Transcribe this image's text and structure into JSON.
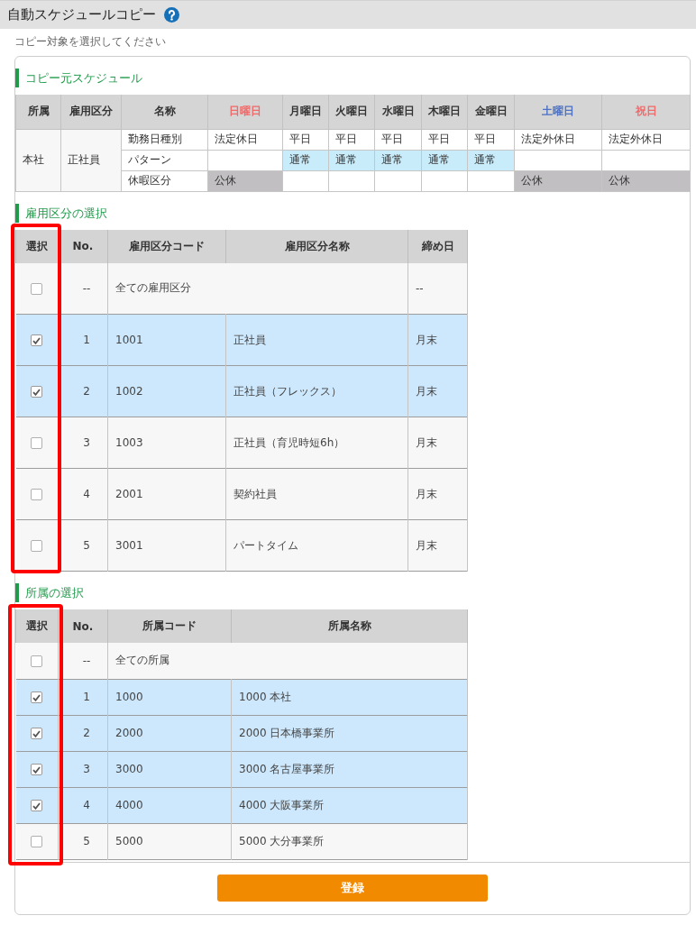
{
  "header": {
    "title": "自動スケジュールコピー"
  },
  "instruction": "コピー対象を選択してください",
  "source_schedule": {
    "title": "コピー元スケジュール",
    "columns": [
      {
        "label": "所属",
        "kind": "key"
      },
      {
        "label": "雇用区分",
        "kind": "key"
      },
      {
        "label": "名称",
        "kind": "key"
      },
      {
        "label": "日曜日",
        "kind": "sunday"
      },
      {
        "label": "月曜日",
        "kind": "weekday"
      },
      {
        "label": "火曜日",
        "kind": "weekday"
      },
      {
        "label": "水曜日",
        "kind": "weekday"
      },
      {
        "label": "木曜日",
        "kind": "weekday"
      },
      {
        "label": "金曜日",
        "kind": "weekday"
      },
      {
        "label": "土曜日",
        "kind": "saturday"
      },
      {
        "label": "祝日",
        "kind": "holiday"
      }
    ],
    "rows": [
      {
        "cells": [
          {
            "kind": "key",
            "text": "本社",
            "rowspan": 3
          },
          {
            "kind": "key",
            "text": "正社員",
            "rowspan": 3
          },
          {
            "kind": "label",
            "text": "勤務日種別"
          },
          {
            "kind": "plain",
            "text": "法定休日"
          },
          {
            "kind": "plain",
            "text": "平日"
          },
          {
            "kind": "plain",
            "text": "平日"
          },
          {
            "kind": "plain",
            "text": "平日"
          },
          {
            "kind": "plain",
            "text": "平日"
          },
          {
            "kind": "plain",
            "text": "平日"
          },
          {
            "kind": "plain",
            "text": "法定外休日"
          },
          {
            "kind": "plain",
            "text": "法定外休日"
          }
        ]
      },
      {
        "cells": [
          {
            "kind": "label",
            "text": "パターン"
          },
          {
            "kind": "plain",
            "text": ""
          },
          {
            "kind": "pattern",
            "text": "通常"
          },
          {
            "kind": "pattern",
            "text": "通常"
          },
          {
            "kind": "pattern",
            "text": "通常"
          },
          {
            "kind": "pattern",
            "text": "通常"
          },
          {
            "kind": "pattern",
            "text": "通常"
          },
          {
            "kind": "plain",
            "text": ""
          },
          {
            "kind": "plain",
            "text": ""
          }
        ]
      },
      {
        "cells": [
          {
            "kind": "label",
            "text": "休暇区分"
          },
          {
            "kind": "off",
            "text": "公休"
          },
          {
            "kind": "plain",
            "text": ""
          },
          {
            "kind": "plain",
            "text": ""
          },
          {
            "kind": "plain",
            "text": ""
          },
          {
            "kind": "plain",
            "text": ""
          },
          {
            "kind": "plain",
            "text": ""
          },
          {
            "kind": "off",
            "text": "公休"
          },
          {
            "kind": "off",
            "text": "公休"
          }
        ]
      }
    ]
  },
  "employment_selection": {
    "title": "雇用区分の選択",
    "select_column_highlighted": true,
    "columns": [
      "選択",
      "No.",
      "雇用区分コード",
      "雇用区分名称",
      "締め日"
    ],
    "all_row": {
      "checked": false,
      "no": "--",
      "label": "全ての雇用区分",
      "closing_day": "--"
    },
    "rows": [
      {
        "checked": true,
        "no": "1",
        "code": "1001",
        "name": "正社員",
        "closing_day": "月末"
      },
      {
        "checked": true,
        "no": "2",
        "code": "1002",
        "name": "正社員（フレックス）",
        "closing_day": "月末"
      },
      {
        "checked": false,
        "no": "3",
        "code": "1003",
        "name": "正社員（育児時短6h）",
        "closing_day": "月末"
      },
      {
        "checked": false,
        "no": "4",
        "code": "2001",
        "name": "契約社員",
        "closing_day": "月末"
      },
      {
        "checked": false,
        "no": "5",
        "code": "3001",
        "name": "パートタイム",
        "closing_day": "月末"
      }
    ]
  },
  "affiliation_selection": {
    "title": "所属の選択",
    "select_column_highlighted": true,
    "columns": [
      "選択",
      "No.",
      "所属コード",
      "所属名称"
    ],
    "all_row": {
      "checked": false,
      "no": "--",
      "label": "全ての所属"
    },
    "rows": [
      {
        "checked": true,
        "no": "1",
        "code": "1000",
        "name": "1000 本社"
      },
      {
        "checked": true,
        "no": "2",
        "code": "2000",
        "name": "2000 日本橋事業所"
      },
      {
        "checked": true,
        "no": "3",
        "code": "3000",
        "name": "3000 名古屋事業所"
      },
      {
        "checked": true,
        "no": "4",
        "code": "4000",
        "name": "4000 大阪事業所"
      },
      {
        "checked": false,
        "no": "5",
        "code": "5000",
        "name": "5000 大分事業所"
      }
    ]
  },
  "submit_button": "登録"
}
